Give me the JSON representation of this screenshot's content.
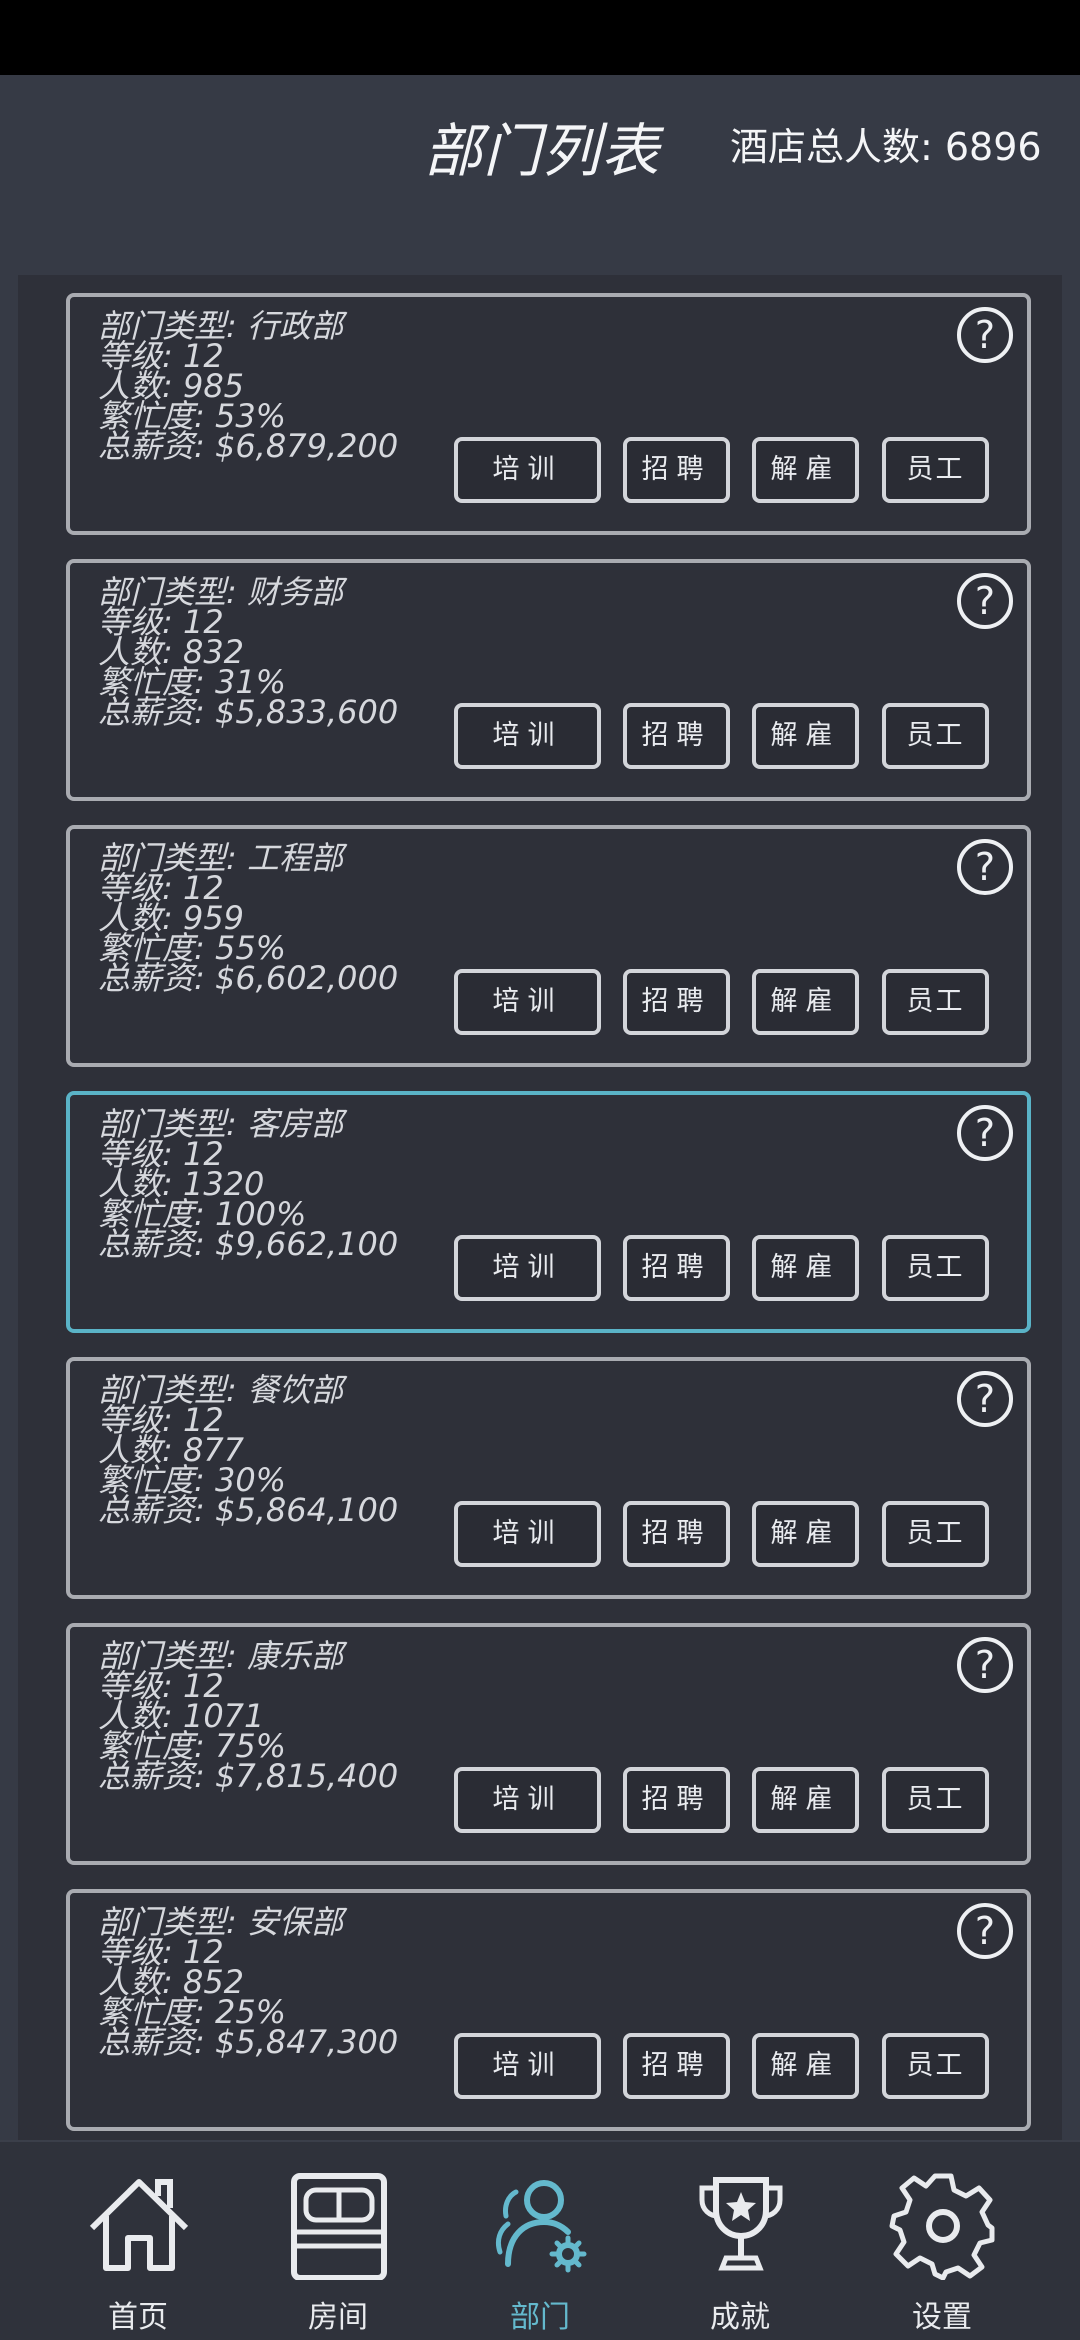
{
  "header": {
    "title": "部门列表",
    "total_label": "酒店总人数: 6896"
  },
  "buttons": {
    "train": "培训",
    "hire": "招聘",
    "fire": "解雇",
    "staff": "员工",
    "help": "?"
  },
  "departments": [
    {
      "type": "部门类型: 行政部",
      "level": "等级: 12",
      "people": "人数: 985",
      "busy": "繁忙度: 53%",
      "salary": "总薪资: $6,879,200",
      "selected": false
    },
    {
      "type": "部门类型: 财务部",
      "level": "等级: 12",
      "people": "人数: 832",
      "busy": "繁忙度: 31%",
      "salary": "总薪资: $5,833,600",
      "selected": false
    },
    {
      "type": "部门类型: 工程部",
      "level": "等级: 12",
      "people": "人数: 959",
      "busy": "繁忙度: 55%",
      "salary": "总薪资: $6,602,000",
      "selected": false
    },
    {
      "type": "部门类型: 客房部",
      "level": "等级: 12",
      "people": "人数: 1320",
      "busy": "繁忙度: 100%",
      "salary": "总薪资: $9,662,100",
      "selected": true
    },
    {
      "type": "部门类型: 餐饮部",
      "level": "等级: 12",
      "people": "人数: 877",
      "busy": "繁忙度: 30%",
      "salary": "总薪资: $5,864,100",
      "selected": false
    },
    {
      "type": "部门类型: 康乐部",
      "level": "等级: 12",
      "people": "人数: 1071",
      "busy": "繁忙度: 75%",
      "salary": "总薪资: $7,815,400",
      "selected": false
    },
    {
      "type": "部门类型: 安保部",
      "level": "等级: 12",
      "people": "人数: 852",
      "busy": "繁忙度: 25%",
      "salary": "总薪资: $5,847,300",
      "selected": false
    }
  ],
  "nav": [
    {
      "label": "首页",
      "icon": "home-icon",
      "active": false
    },
    {
      "label": "房间",
      "icon": "bed-icon",
      "active": false
    },
    {
      "label": "部门",
      "icon": "department-users-gear-icon",
      "active": true
    },
    {
      "label": "成就",
      "icon": "trophy-star-icon",
      "active": false
    },
    {
      "label": "设置",
      "icon": "gear-icon",
      "active": false
    }
  ],
  "colors": {
    "background": "#363a45",
    "list_bg": "#2e3039",
    "card_border": "#a9abb1",
    "selected_border": "#5ab3c7",
    "active_nav": "#64b9cd"
  }
}
